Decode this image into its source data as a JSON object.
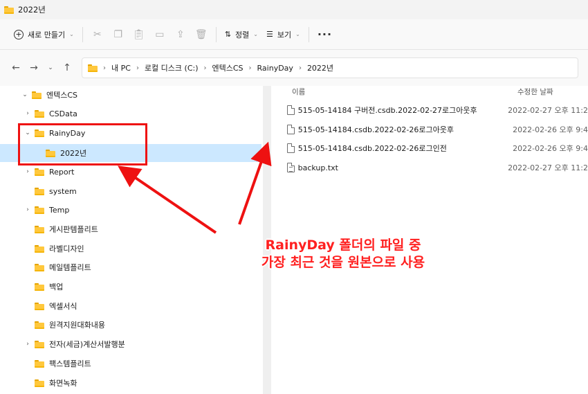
{
  "window": {
    "title": "2022년"
  },
  "toolbar": {
    "new_label": "새로 만들기",
    "sort_label": "정렬",
    "view_label": "보기",
    "more_label": "···"
  },
  "address": {
    "crumbs": [
      "내 PC",
      "로컬 디스크 (C:)",
      "엔텍스CS",
      "RainyDay",
      "2022년"
    ]
  },
  "tree": {
    "root": "엔텍스CS",
    "items": [
      {
        "label": "CSData"
      },
      {
        "label": "RainyDay"
      },
      {
        "label": "2022년"
      },
      {
        "label": "Report"
      },
      {
        "label": "system"
      },
      {
        "label": "Temp"
      },
      {
        "label": "게시판템플리트"
      },
      {
        "label": "라벨디자인"
      },
      {
        "label": "메일템플리트"
      },
      {
        "label": "백업"
      },
      {
        "label": "엑셀서식"
      },
      {
        "label": "원격지원대화내용"
      },
      {
        "label": "전자(세금)계산서발행분"
      },
      {
        "label": "팩스템플리트"
      },
      {
        "label": "화면녹화"
      }
    ]
  },
  "files": {
    "header_name": "이름",
    "header_date": "수정한 날짜",
    "rows": [
      {
        "name": "515-05-14184 구버전.csdb.2022-02-27로그아웃후",
        "date": "2022-02-27 오후 11:2"
      },
      {
        "name": "515-05-14184.csdb.2022-02-26로그아웃후",
        "date": "2022-02-26 오후 9:4"
      },
      {
        "name": "515-05-14184.csdb.2022-02-26로그인전",
        "date": "2022-02-26 오후 9:4"
      },
      {
        "name": "backup.txt",
        "date": "2022-02-27 오후 11:2"
      }
    ]
  },
  "annotation": {
    "line1": "RainyDay 폴더의 파일 중",
    "line2": "가장 최근 것을 원본으로 사용"
  },
  "colors": {
    "annotation": "#ff2020",
    "selection": "#cce8ff",
    "folder": "#ffc83d"
  }
}
